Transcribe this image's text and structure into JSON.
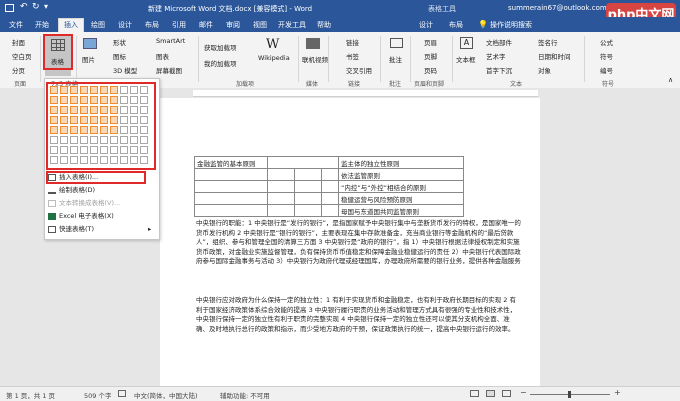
{
  "window": {
    "title": "新建 Microsoft Word 文档.docx [兼容模式] - Word",
    "context_tab": "表格工具",
    "user": "summerain67@outlook.com",
    "watermark": "php中文网"
  },
  "tabs": [
    "文件",
    "开始",
    "插入",
    "绘图",
    "设计",
    "布局",
    "引用",
    "邮件",
    "审阅",
    "视图",
    "开发工具",
    "帮助",
    "设计",
    "布局",
    "操作说明搜索"
  ],
  "active_tab": "插入",
  "ribbon": {
    "pages": {
      "cover": "封面",
      "blank": "空白页",
      "break": "分页",
      "label": "页面"
    },
    "table": {
      "button": "表格",
      "label": "表格"
    },
    "illustrations": {
      "picture": "图片",
      "shapes": "形状",
      "icons": "图标",
      "model3d": "3D 模型",
      "smartart": "SmartArt",
      "chart": "图表",
      "screenshot": "屏幕截图"
    },
    "addins": {
      "get": "获取加载项",
      "mine": "我的加载项",
      "wikipedia": "Wikipedia",
      "label": "加载项"
    },
    "media": {
      "video": "联机视频",
      "label": "媒体"
    },
    "links": {
      "link": "链接",
      "bookmark": "书签",
      "crossref": "交叉引用",
      "label": "链接"
    },
    "comments": {
      "comment": "批注",
      "label": "批注"
    },
    "header_footer": {
      "header": "页眉",
      "footer": "页脚",
      "page_number": "页码",
      "label": "页眉和页脚"
    },
    "text": {
      "textbox": "文本框",
      "docparts": "文档部件",
      "wordart": "艺术字",
      "dropcap": "首字下沉",
      "signature": "签名行",
      "datetime": "日期和时间",
      "object": "对象",
      "label": "文本"
    },
    "symbols": {
      "equation": "公式",
      "symbol": "符号",
      "number": "编号",
      "label": "符号"
    }
  },
  "dropdown": {
    "grid_label": "7x5 表格",
    "grid_cols": 10,
    "grid_rows": 8,
    "sel_cols": 7,
    "sel_rows": 5,
    "items": [
      "插入表格(I)...",
      "绘制表格(D)",
      "文本转换成表格(V)...",
      "Excel 电子表格(X)",
      "快速表格(T)"
    ]
  },
  "doc_table": {
    "rows": [
      [
        "金融监管的基本原则",
        "",
        "",
        "",
        "监主体的独立性原则"
      ],
      [
        "",
        "",
        "",
        "",
        "依法监管原则"
      ],
      [
        "",
        "",
        "",
        "",
        "“内控”与“外控”相结合的原则"
      ],
      [
        "",
        "",
        "",
        "",
        "稳健运营与风险预防原则"
      ],
      [
        "",
        "",
        "",
        "",
        "母国与东道国共同监管原则"
      ]
    ]
  },
  "paragraphs": [
    "中央银行的职能：1 中央银行是“发行的银行”，是指国家赋予中央银行集中与垄断货币发行的特权，是国家唯一的货币发行机构 2 中央银行是“银行的银行”，主要表现在集中存款准备金，充当商业银行等金融机构的“最后贷款人”，组织、参与和管理全国的清算三方面 3 中央银行是“政府的银行”，指 1）中央银行根据法律授权制定和实施货币政策，对金融业实施监督管理，负有保持货币币值稳定和保障金融业稳健运行的责任 2）中央银行代表国际政府参与国际金融事务与活动 3）中央银行为政府代理或经理国库，办理政府所需要的银行业务，提供各种金融服务",
    "中央银行应对政府为什么保持一定的独立性：1 有利于实现货币和金融稳定，也有利于政府长期目标的实现 2 有利于国家经济政策体系综合效能的提高 3 中央银行履行职责的业务活动和管理方式具有很强的专业性和技术性，中央银行保持一定的独立性有利于职责的完整实现 4 中央银行保持一定的独立性还可以使其分支机构全面、准确、及时地执行总行的政策和指示，而少受地方政府的干预，保证政策执行的统一，提高中央银行运行的效率。"
  ],
  "status": {
    "page": "第 1 页，共 1 页",
    "words": "509 个字",
    "language": "中文(简体，中国大陆)",
    "accessibility": "辅助功能: 不可用"
  }
}
